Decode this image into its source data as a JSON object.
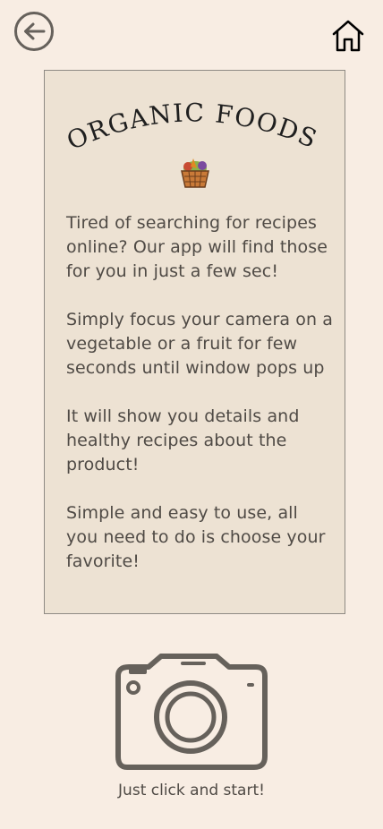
{
  "header": {
    "back_icon": "circle-arrow-left-icon",
    "home_icon": "home-icon"
  },
  "card": {
    "title": "ORGANIC FOODS",
    "basket_icon": "vegetable-basket-icon",
    "paragraphs": [
      "Tired of searching for recipes online? Our app will find those for you in just a few sec!",
      "Simply focus your camera on a vegetable or a fruit for few seconds until window pops up",
      "It will show you details and healthy recipes about the product!",
      "Simple and easy to use, all you need to do is choose your favorite!"
    ]
  },
  "action": {
    "camera_icon": "camera-icon",
    "label": "Just click and start!"
  },
  "colors": {
    "background": "#f8ede3",
    "card": "#ede2d3",
    "text": "#4f4a45",
    "icon": "#66615b"
  }
}
